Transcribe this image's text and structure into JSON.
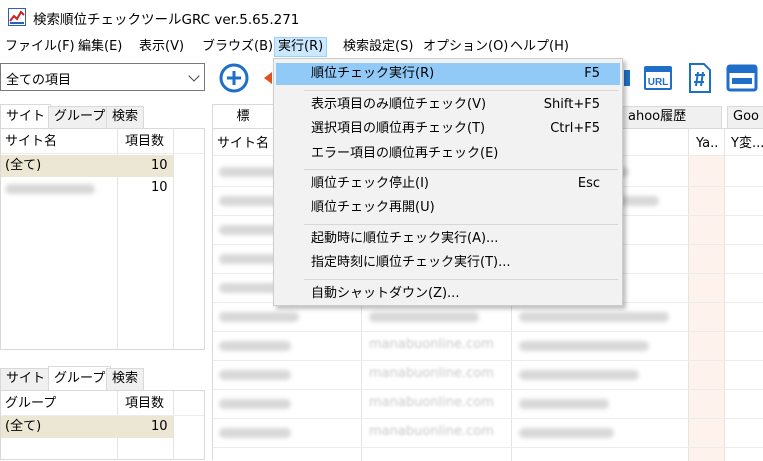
{
  "window": {
    "title": "検索順位チェックツールGRC  ver.5.65.271"
  },
  "menubar": {
    "items": [
      "ファイル(F)",
      "編集(E)",
      "表示(V)",
      "ブラウズ(B)",
      "実行(R)",
      "検索設定(S)",
      "オプション(O)",
      "ヘルプ(H)"
    ],
    "active_index": 4
  },
  "toolbar": {
    "filter_value": "全ての項目",
    "url_label": "URL"
  },
  "run_menu": {
    "items": [
      {
        "label": "順位チェック実行(R)",
        "shortcut": "F5"
      },
      {
        "label": "表示項目のみ順位チェック(V)",
        "shortcut": "Shift+F5"
      },
      {
        "label": "選択項目の順位再チェック(T)",
        "shortcut": "Ctrl+F5"
      },
      {
        "label": "エラー項目の順位再チェック(E)",
        "shortcut": ""
      },
      {
        "label": "順位チェック停止(I)",
        "shortcut": "Esc"
      },
      {
        "label": "順位チェック再開(U)",
        "shortcut": ""
      },
      {
        "label": "起動時に順位チェック実行(A)...",
        "shortcut": ""
      },
      {
        "label": "指定時刻に順位チェック実行(T)...",
        "shortcut": ""
      },
      {
        "label": "自動シャットダウン(Z)...",
        "shortcut": ""
      }
    ]
  },
  "left_top": {
    "tabs": [
      "サイト",
      "グループ",
      "検索"
    ],
    "columns": [
      "サイト名",
      "項目数"
    ],
    "rows": [
      {
        "name": "(全て)",
        "count": "10"
      },
      {
        "name": "",
        "count": "10"
      }
    ]
  },
  "left_bottom": {
    "tabs": [
      "サイト",
      "グループ",
      "検索"
    ],
    "columns": [
      "グループ",
      "項目数"
    ],
    "rows": [
      {
        "name": "(全て)",
        "count": "10"
      }
    ]
  },
  "main": {
    "tabs": [
      "標",
      "ahoo履歴",
      "Goo"
    ],
    "columns": [
      "サイト名",
      "Ya..",
      "Y変..."
    ],
    "url_col_values": [
      "manabuonline.com",
      "manabuonline.com",
      "manabuonline.com",
      "manabuonline.com"
    ]
  },
  "colors": {
    "highlight": "#91c9f7",
    "menu_active": "#cce8ff",
    "row_selected": "#ece7d4"
  }
}
